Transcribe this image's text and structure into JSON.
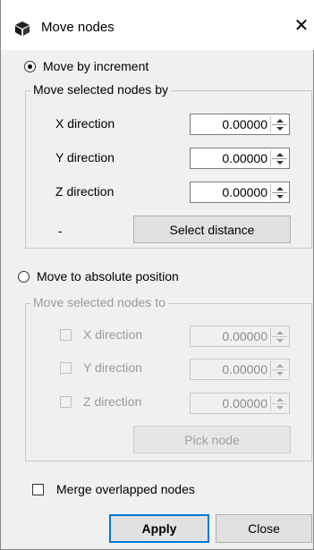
{
  "window": {
    "title": "Move nodes",
    "close_glyph": "✕",
    "title_icon": "cube-icon"
  },
  "increment": {
    "radio_label": "Move by increment",
    "selected": true,
    "group_title": "Move selected nodes by",
    "rows": [
      {
        "label": "X direction",
        "value": "0.00000"
      },
      {
        "label": "Y direction",
        "value": "0.00000"
      },
      {
        "label": "Z direction",
        "value": "0.00000"
      }
    ],
    "distance_label": "-",
    "select_distance_label": "Select distance"
  },
  "absolute": {
    "radio_label": "Move to absolute position",
    "selected": false,
    "group_title": "Move selected nodes to",
    "rows": [
      {
        "label": "X direction",
        "value": "0.00000",
        "checked": false
      },
      {
        "label": "Y direction",
        "value": "0.00000",
        "checked": false
      },
      {
        "label": "Z direction",
        "value": "0.00000",
        "checked": false
      }
    ],
    "pick_node_label": "Pick node"
  },
  "merge": {
    "label": "Merge overlapped nodes",
    "checked": false
  },
  "footer": {
    "apply_label": "Apply",
    "close_label": "Close"
  }
}
